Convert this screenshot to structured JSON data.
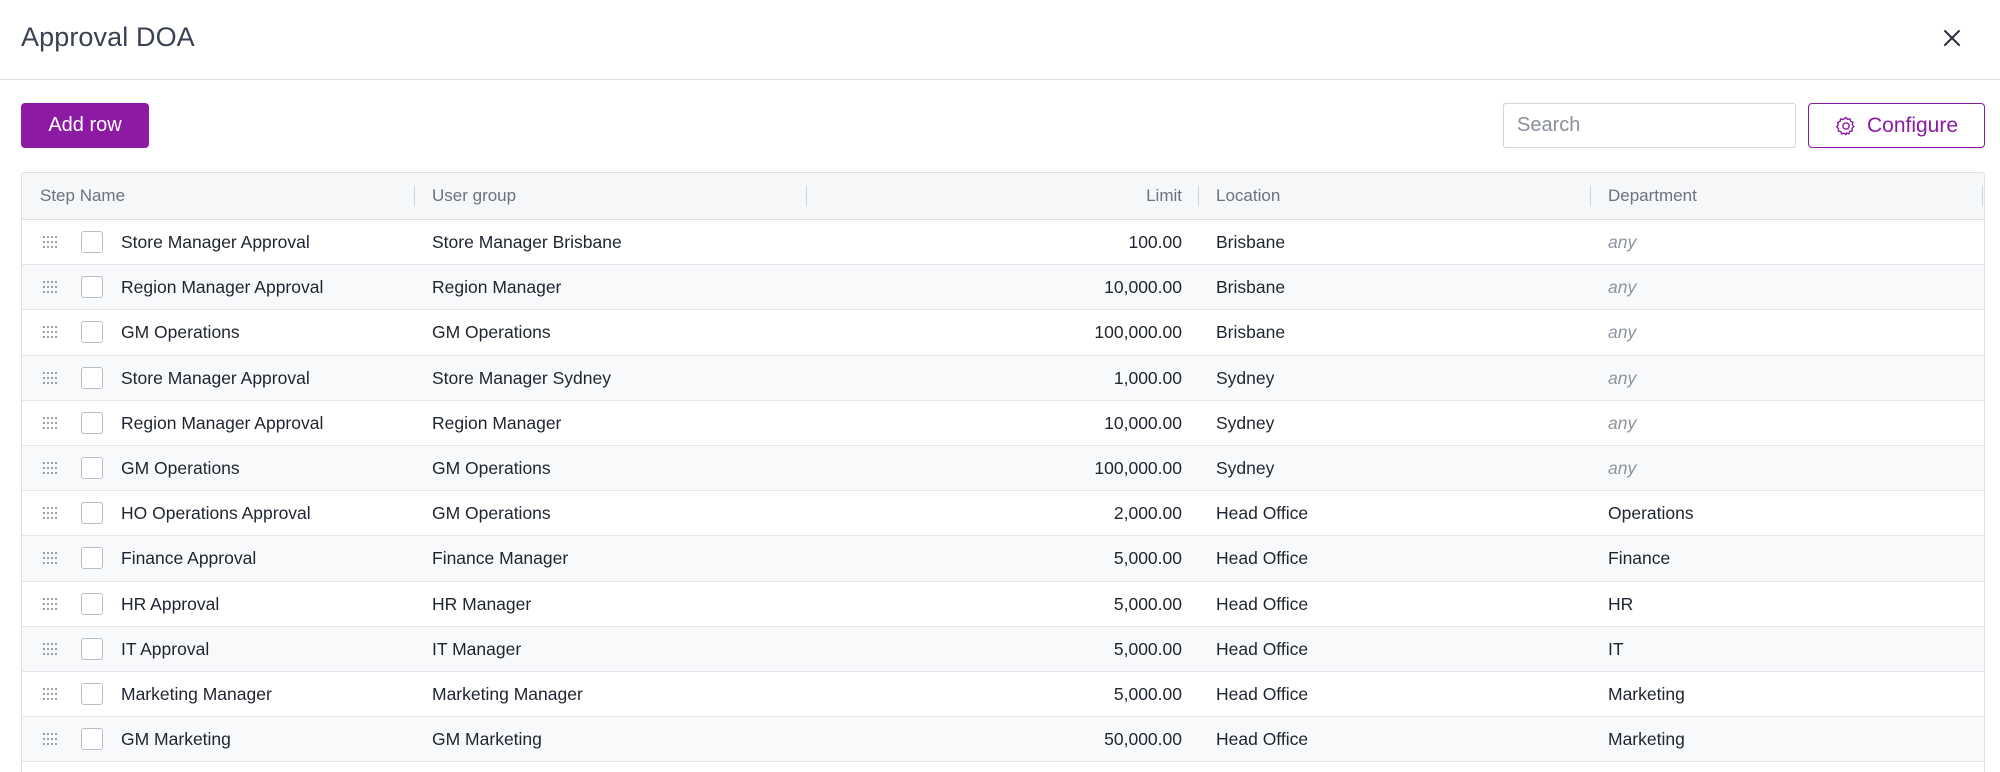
{
  "dialog": {
    "title": "Approval DOA"
  },
  "toolbar": {
    "add_row_label": "Add row",
    "search_placeholder": "Search",
    "configure_label": "Configure"
  },
  "table": {
    "columns": {
      "step_name": "Step Name",
      "user_group": "User group",
      "limit": "Limit",
      "location": "Location",
      "department": "Department"
    },
    "rows": [
      {
        "step": "Store Manager Approval",
        "group": "Store Manager Brisbane",
        "limit": "100.00",
        "location": "Brisbane",
        "department": "any"
      },
      {
        "step": "Region Manager Approval",
        "group": "Region Manager",
        "limit": "10,000.00",
        "location": "Brisbane",
        "department": "any"
      },
      {
        "step": "GM Operations",
        "group": "GM Operations",
        "limit": "100,000.00",
        "location": "Brisbane",
        "department": "any"
      },
      {
        "step": "Store Manager Approval",
        "group": "Store Manager Sydney",
        "limit": "1,000.00",
        "location": "Sydney",
        "department": "any"
      },
      {
        "step": "Region Manager Approval",
        "group": "Region Manager",
        "limit": "10,000.00",
        "location": "Sydney",
        "department": "any"
      },
      {
        "step": "GM Operations",
        "group": "GM Operations",
        "limit": "100,000.00",
        "location": "Sydney",
        "department": "any"
      },
      {
        "step": "HO Operations Approval",
        "group": "GM Operations",
        "limit": "2,000.00",
        "location": "Head Office",
        "department": "Operations"
      },
      {
        "step": "Finance Approval",
        "group": "Finance Manager",
        "limit": "5,000.00",
        "location": "Head Office",
        "department": "Finance"
      },
      {
        "step": "HR Approval",
        "group": "HR Manager",
        "limit": "5,000.00",
        "location": "Head Office",
        "department": "HR"
      },
      {
        "step": "IT Approval",
        "group": "IT Manager",
        "limit": "5,000.00",
        "location": "Head Office",
        "department": "IT"
      },
      {
        "step": "Marketing Manager",
        "group": "Marketing Manager",
        "limit": "5,000.00",
        "location": "Head Office",
        "department": "Marketing"
      },
      {
        "step": "GM Marketing",
        "group": "GM Marketing",
        "limit": "50,000.00",
        "location": "Head Office",
        "department": "Marketing"
      }
    ]
  },
  "icons": {
    "close": "close-icon",
    "gear": "gear-icon",
    "drag": "drag-handle-icon"
  },
  "colors": {
    "accent": "#8c1aa3",
    "placeholder_any": "#8e939c"
  }
}
